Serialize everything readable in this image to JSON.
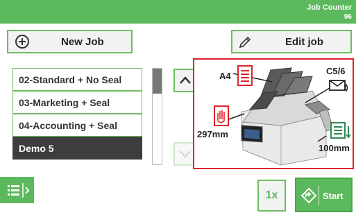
{
  "header": {
    "job_counter_label": "Job Counter",
    "job_counter_value": "96"
  },
  "toolbar": {
    "new_job_label": "New Job",
    "edit_job_label": "Edit job"
  },
  "jobs": [
    {
      "label": "02-Standard + No Seal",
      "selected": false
    },
    {
      "label": "03-Marketing + Seal",
      "selected": false
    },
    {
      "label": "04-Accounting + Seal",
      "selected": false
    },
    {
      "label": "Demo 5",
      "selected": true
    }
  ],
  "machine": {
    "insert_format": "A4",
    "envelope_format": "C5/6",
    "insert_length": "297mm",
    "envelope_height": "100mm"
  },
  "footer": {
    "copies_label": "1x",
    "start_label": "Start"
  },
  "colors": {
    "accent": "#5cb85c",
    "selected_row": "#3d3d3d",
    "highlight_border": "#e0222a",
    "icon_red": "#e0222a"
  },
  "icons": {
    "new_job": "plus-circle-icon",
    "edit_job": "pencil-icon",
    "scroll_up": "chevron-up-icon",
    "scroll_down": "chevron-down-icon",
    "menu": "list-menu-icon",
    "start": "diamond-arrow-icon",
    "insert": "document-icon",
    "envelope": "envelope-seal-icon",
    "length": "hand-stop-icon",
    "height": "document-height-icon"
  }
}
